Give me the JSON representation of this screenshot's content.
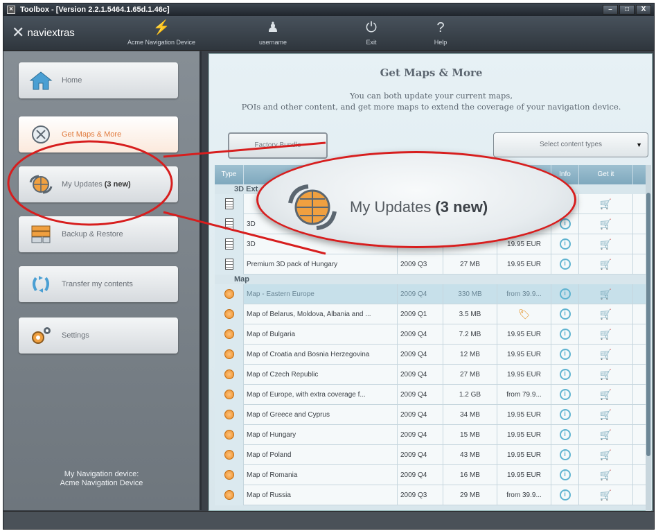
{
  "window": {
    "title": "Toolbox - [Version 2.2.1.5464.1.65d.1.46c]",
    "buttons": [
      "–",
      "□",
      "X"
    ]
  },
  "header": {
    "brand": "naviextras",
    "device": "Acme Navigation Device",
    "user": "username",
    "exit": "Exit",
    "help": "Help"
  },
  "sidebar": {
    "items": [
      {
        "label": "Home",
        "icon": "home-icon"
      },
      {
        "label": "Get Maps & More",
        "icon": "maps-icon",
        "active": true
      },
      {
        "label": "My Updates",
        "badge": "(3 new)",
        "icon": "updates-globe-icon"
      },
      {
        "label": "Backup & Restore",
        "icon": "backup-icon"
      },
      {
        "label": "Transfer my contents",
        "icon": "transfer-icon"
      },
      {
        "label": "Settings",
        "icon": "gear-icon"
      }
    ],
    "device_label": "My Navigation device:",
    "device_name": "Acme Navigation Device"
  },
  "main": {
    "title": "Get Maps & More",
    "description_line1": "You can both update your current maps,",
    "description_line2": "POIs and other content, and get more maps to extend the coverage of your navigation device.",
    "factory_button": "Factory Bundle",
    "select_placeholder": "Select content types",
    "columns": [
      "Type",
      "",
      "",
      "",
      "",
      "Info",
      "Get it"
    ],
    "groups": [
      {
        "name": "3D Ext",
        "rows": [
          {
            "name": "",
            "version": "",
            "size": "",
            "price": ""
          },
          {
            "name": "3D",
            "version": "",
            "size": "",
            "price": ""
          },
          {
            "name": "3D",
            "version": "",
            "size": "",
            "price": "19.95 EUR"
          },
          {
            "name": "Premium 3D pack of Hungary",
            "version": "2009 Q3",
            "size": "27 MB",
            "price": "19.95 EUR"
          }
        ]
      },
      {
        "name": "Map",
        "rows": [
          {
            "name": "Map - Eastern Europe",
            "version": "2009 Q4",
            "size": "330 MB",
            "price": "from 39.9...",
            "selected": true
          },
          {
            "name": "Map of Belarus, Moldova, Albania and ...",
            "version": "2009 Q1",
            "size": "3.5 MB",
            "price": "",
            "tag": true
          },
          {
            "name": "Map of Bulgaria",
            "version": "2009 Q4",
            "size": "7.2 MB",
            "price": "19.95 EUR"
          },
          {
            "name": "Map of Croatia and Bosnia Herzegovina",
            "version": "2009 Q4",
            "size": "12 MB",
            "price": "19.95 EUR"
          },
          {
            "name": "Map of Czech Republic",
            "version": "2009 Q4",
            "size": "27 MB",
            "price": "19.95 EUR"
          },
          {
            "name": "Map of Europe, with extra coverage f...",
            "version": "2009 Q4",
            "size": "1.2 GB",
            "price": "from 79.9..."
          },
          {
            "name": "Map of Greece and Cyprus",
            "version": "2009 Q4",
            "size": "34 MB",
            "price": "19.95 EUR"
          },
          {
            "name": "Map of Hungary",
            "version": "2009 Q4",
            "size": "15 MB",
            "price": "19.95 EUR"
          },
          {
            "name": "Map of Poland",
            "version": "2009 Q4",
            "size": "43 MB",
            "price": "19.95 EUR"
          },
          {
            "name": "Map of Romania",
            "version": "2009 Q4",
            "size": "16 MB",
            "price": "19.95 EUR"
          },
          {
            "name": "Map of Russia",
            "version": "2009 Q3",
            "size": "29 MB",
            "price": "from 39.9..."
          }
        ]
      }
    ]
  },
  "callout": {
    "label": "My Updates",
    "badge": "(3 new)",
    "color": "#d71e1e"
  }
}
